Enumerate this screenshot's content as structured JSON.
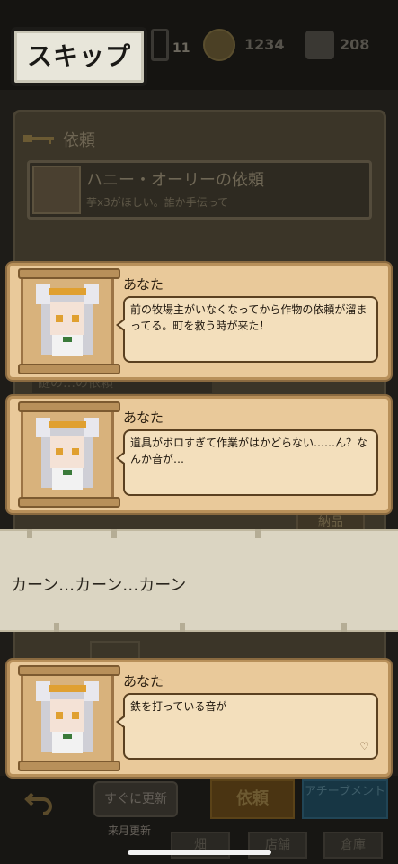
{
  "top_hud": {
    "skip_label": "スキップ",
    "small_count": "11",
    "coins": "1234",
    "gems": "208"
  },
  "background_panel": {
    "header": "依頼",
    "request_title": "ハニー・オーリーの依頼",
    "request_subtitle": "芋x3がほしい。誰か手伝って",
    "faint_label_1": "謎の…の依頼",
    "faint_label_2": "納品"
  },
  "dialogs": [
    {
      "speaker": "あなた",
      "text": "前の牧場主がいなくなってから作物の依頼が溜まってる。町を救う時が来た！"
    },
    {
      "speaker": "あなた",
      "text": "道具がボロすぎて作業がはかどらない……ん？なんか音が…"
    },
    {
      "speaker": "あなた",
      "text": "鉄を打っている音が",
      "indicator": "♡"
    }
  ],
  "banner": {
    "text": "カーン…カーン…カーン"
  },
  "bottom_bar": {
    "refresh_label": "すぐに更新",
    "refresh_caption": "来月更新",
    "request_tab": "依頼",
    "achievement_tab": "アチーブメント",
    "tab_2": "畑",
    "tab_3": "店舗",
    "tab_4": "倉庫"
  },
  "colors": {
    "dialog_bg": "#e9c99a",
    "dialog_border": "#b8905a",
    "banner_bg": "#dbd5c2",
    "skip_bg": "#e8e6da"
  }
}
